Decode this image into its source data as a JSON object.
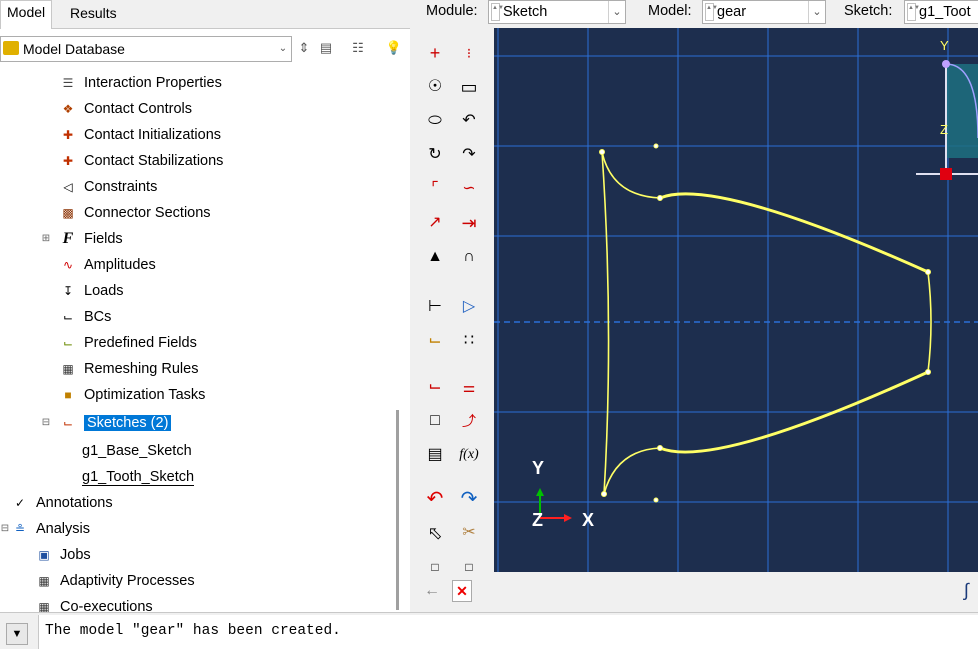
{
  "left_panel": {
    "tabs": [
      {
        "label": "Model"
      },
      {
        "label": "Results"
      }
    ],
    "database_label": "Model Database",
    "tree": [
      {
        "label": "Interaction Properties",
        "icon": "interaction-properties-icon"
      },
      {
        "label": "Contact Controls",
        "icon": "contact-controls-icon"
      },
      {
        "label": "Contact Initializations",
        "icon": "contact-initializations-icon"
      },
      {
        "label": "Contact Stabilizations",
        "icon": "contact-stabilizations-icon"
      },
      {
        "label": "Constraints",
        "icon": "constraints-icon"
      },
      {
        "label": "Connector Sections",
        "icon": "connector-sections-icon"
      },
      {
        "label": "Fields",
        "icon": "fields-icon"
      },
      {
        "label": "Amplitudes",
        "icon": "amplitudes-icon"
      },
      {
        "label": "Loads",
        "icon": "loads-icon"
      },
      {
        "label": "BCs",
        "icon": "bcs-icon"
      },
      {
        "label": "Predefined Fields",
        "icon": "predefined-fields-icon"
      },
      {
        "label": "Remeshing Rules",
        "icon": "remeshing-rules-icon"
      },
      {
        "label": "Optimization Tasks",
        "icon": "optimization-tasks-icon"
      },
      {
        "label": "Sketches (2)",
        "icon": "sketches-icon"
      },
      {
        "label": "g1_Base_Sketch",
        "icon": ""
      },
      {
        "label": "g1_Tooth_Sketch",
        "icon": ""
      },
      {
        "label": "Annotations",
        "icon": "annotations-icon"
      },
      {
        "label": "Analysis",
        "icon": "analysis-icon"
      },
      {
        "label": "Jobs",
        "icon": "jobs-icon"
      },
      {
        "label": "Adaptivity Processes",
        "icon": "adaptivity-processes-icon"
      },
      {
        "label": "Co-executions",
        "icon": "co-executions-icon"
      }
    ]
  },
  "context_bar": {
    "module_label": "Module:",
    "module_value": "Sketch",
    "model_label": "Model:",
    "model_value": "gear",
    "sketch_label": "Sketch:",
    "sketch_value": "g1_Toot"
  },
  "viewport": {
    "background_color": "#1d2e4e",
    "grid_color": "#2b6fd6",
    "profile_color": "#ffff66",
    "triad_labels": {
      "y": "Y",
      "z": "Z",
      "x": "X"
    },
    "mini_triad_labels": {
      "y": "Y",
      "z": "Z"
    }
  },
  "message_area": {
    "text": "The model \"gear\" has been created."
  },
  "colors": {
    "selection": "#0078d7",
    "triad_y": "#00c000",
    "triad_x": "#ff2020"
  }
}
